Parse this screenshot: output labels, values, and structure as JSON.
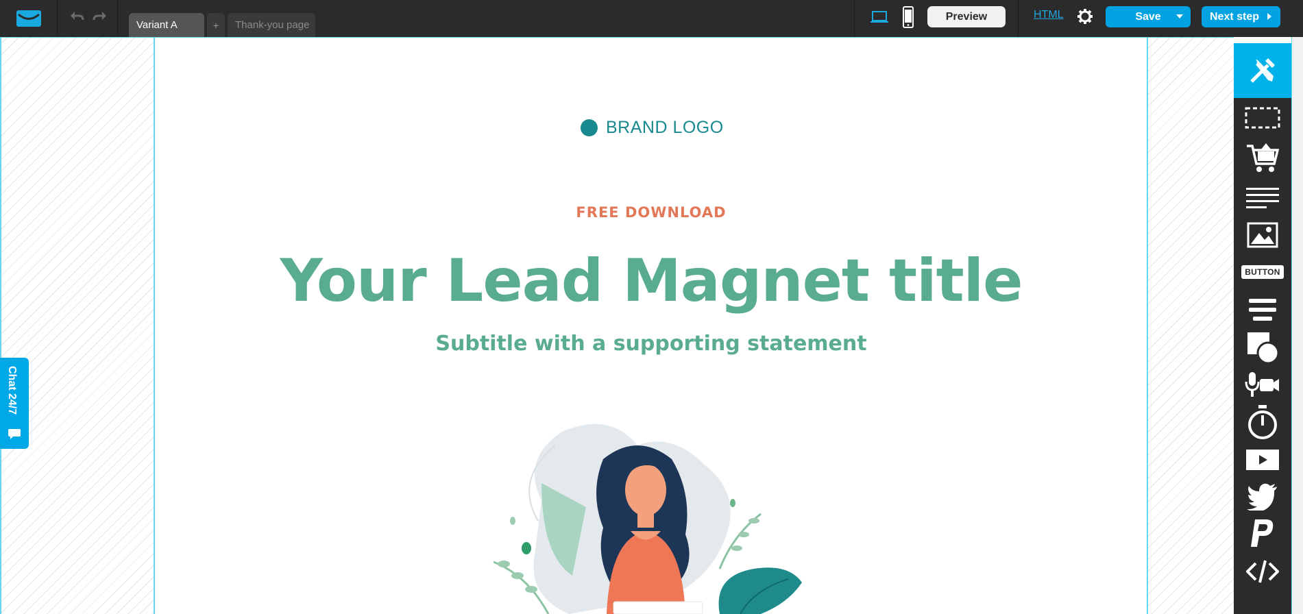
{
  "topbar": {
    "tabs": [
      {
        "label": "Variant A"
      },
      {
        "label": "+"
      },
      {
        "label": "Thank-you page"
      }
    ],
    "preview_label": "Preview",
    "html_label": "HTML",
    "save_label": "Save",
    "next_label": "Next step"
  },
  "page": {
    "brand_logo": "BRAND LOGO",
    "eyebrow": "FREE DOWNLOAD",
    "title": "Your Lead Magnet title",
    "subtitle": "Subtitle with a supporting statement"
  },
  "chat": {
    "label": "Chat 24/7"
  },
  "toolbar": {
    "items": [
      {
        "icon": "design-tools-icon"
      },
      {
        "icon": "section-icon"
      },
      {
        "icon": "cart-icon"
      },
      {
        "icon": "text-icon"
      },
      {
        "icon": "image-icon"
      },
      {
        "icon": "button-icon",
        "label": "BUTTON"
      },
      {
        "icon": "form-icon"
      },
      {
        "icon": "shapes-icon"
      },
      {
        "icon": "webinar-icon"
      },
      {
        "icon": "timer-icon"
      },
      {
        "icon": "video-icon"
      },
      {
        "icon": "twitter-icon"
      },
      {
        "icon": "paypal-icon"
      },
      {
        "icon": "code-icon"
      }
    ]
  },
  "colors": {
    "topbar": "#2b2b2b",
    "accent": "#00a2e2",
    "brand_teal": "#17898f",
    "headline_green": "#5aac8f",
    "eyebrow_orange": "#e27858"
  }
}
